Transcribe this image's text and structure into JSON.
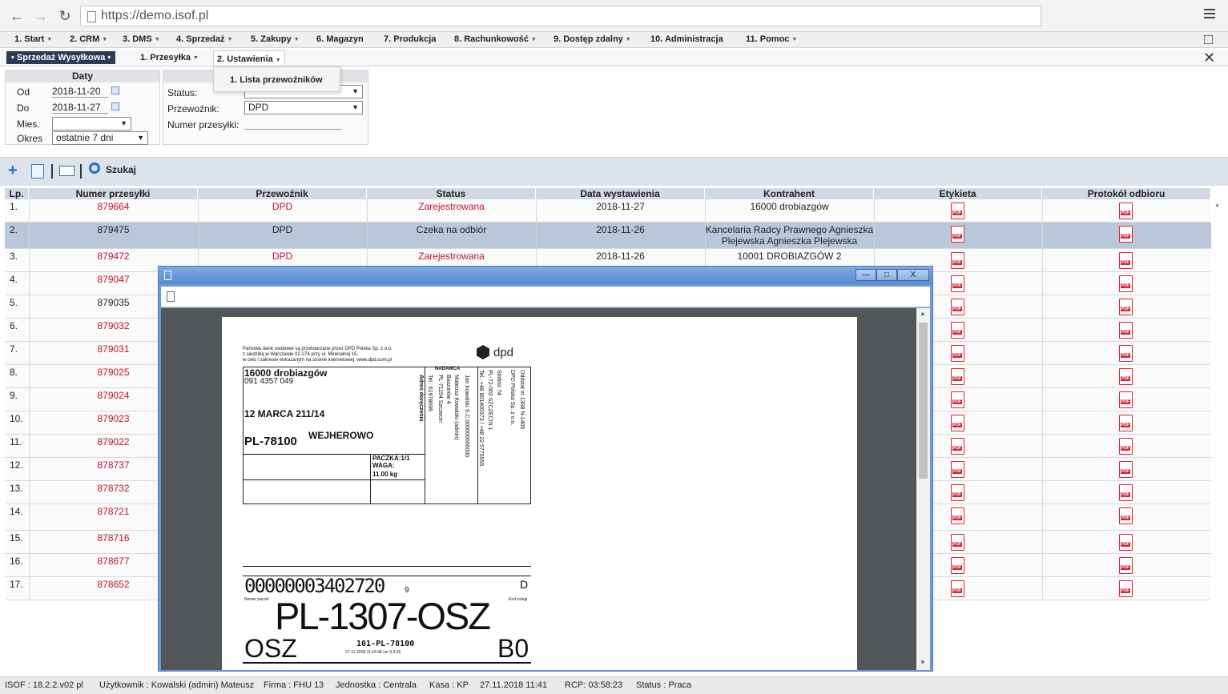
{
  "browser": {
    "url": "https://demo.isof.pl"
  },
  "main_menu": [
    {
      "label": "1. Start",
      "caret": true
    },
    {
      "label": "2. CRM",
      "caret": true
    },
    {
      "label": "3. DMS",
      "caret": true
    },
    {
      "label": "4. Sprzedaż",
      "caret": true
    },
    {
      "label": "5. Zakupy",
      "caret": true
    },
    {
      "label": "6. Magazyn",
      "caret": false
    },
    {
      "label": "7. Produkcja",
      "caret": false
    },
    {
      "label": "8. Rachunkowość",
      "caret": true
    },
    {
      "label": "9. Dostęp zdalny",
      "caret": true
    },
    {
      "label": "10. Administracja",
      "caret": false
    },
    {
      "label": "11. Pomoc",
      "caret": true
    }
  ],
  "sub_menu": {
    "active": "Sprzedaż Wysyłkowa",
    "item1": "1. Przesyłka",
    "item2": "2. Ustawienia",
    "dropdown_item": "1. Lista przewoźników"
  },
  "filters": {
    "dates_title": "Daty",
    "from_label": "Od",
    "from_value": "2018-11-20",
    "to_label": "Do",
    "to_value": "2018-11-27",
    "month_label": "Mies.",
    "month_value": "",
    "period_label": "Okres",
    "period_value": "ostatnie 7 dni",
    "status_label": "Status:",
    "status_value": "",
    "carrier_label": "Przewoźnik:",
    "carrier_value": "DPD",
    "number_label": "Numer przesyłki:",
    "number_value": ""
  },
  "toolbar": {
    "search_label": "Szukaj"
  },
  "table": {
    "headers": [
      "Lp.",
      "Numer przesyłki",
      "Przewoźnik",
      "Status",
      "Data wystawienia",
      "Kontrahent",
      "Etykieta",
      "Protokół odbioru"
    ],
    "rows": [
      {
        "lp": "1.",
        "num": "879664",
        "carrier": "DPD",
        "status": "Zarejestrowana",
        "date": "2018-11-27",
        "client": "16000 drobiazgów",
        "red": true
      },
      {
        "lp": "2.",
        "num": "879475",
        "carrier": "DPD",
        "status": "Czeka na odbiór",
        "date": "2018-11-26",
        "client": "Kancelaria Radcy Prawnego Agnieszka Plejewska Agnieszka Plejewska",
        "red": false
      },
      {
        "lp": "3.",
        "num": "879472",
        "carrier": "DPD",
        "status": "Zarejestrowana",
        "date": "2018-11-26",
        "client": "10001 DROBIAZGÓW 2",
        "red": true
      },
      {
        "lp": "4.",
        "num": "879047",
        "red": true
      },
      {
        "lp": "5.",
        "num": "879035",
        "red": false
      },
      {
        "lp": "6.",
        "num": "879032",
        "red": true
      },
      {
        "lp": "7.",
        "num": "879031",
        "red": true
      },
      {
        "lp": "8.",
        "num": "879025",
        "red": true
      },
      {
        "lp": "9.",
        "num": "879024",
        "red": true
      },
      {
        "lp": "10.",
        "num": "879023",
        "red": true
      },
      {
        "lp": "11.",
        "num": "879022",
        "red": true
      },
      {
        "lp": "12.",
        "num": "878737",
        "red": true
      },
      {
        "lp": "13.",
        "num": "878732",
        "red": true
      },
      {
        "lp": "14.",
        "num": "878721",
        "red": true
      },
      {
        "lp": "15.",
        "num": "878716",
        "red": true
      },
      {
        "lp": "16.",
        "num": "878677",
        "red": true
      },
      {
        "lp": "17.",
        "num": "878652",
        "red": true
      }
    ]
  },
  "popup": {
    "btn_min": "—",
    "btn_max": "□",
    "btn_close": "X",
    "label": {
      "privacy": [
        "Państwa dane osobowe są przetwarzane przez DPD Polska Sp. z o.o.",
        "z siedzibą w Warszawie 02-274 przy ul. Mineralnej 15,",
        "w celu i zakresie wskazanym na stronie internetowej: www.dpd.com.pl"
      ],
      "brand": "dpd",
      "recipient_name": "16000 drobiazgów",
      "recipient_phone": "091 4357 049",
      "recipient_street": "12 MARCA 211/14",
      "recipient_postal": "PL-78100",
      "recipient_city": "WEJHEROWO",
      "parcel": "PACZKA:1/1",
      "weight_label": "WAGA:",
      "weight": "11.00 kg",
      "v_address": "Adres doręczenia",
      "v_phone": "Tel.: 61978699",
      "v_sender_title": "NADAWCA",
      "v_sender1": "PL-71154 Szczecin",
      "v_sender2": "Baszarów 4",
      "v_sender3": "Mateusz Kowalski (admin)",
      "v_sender4": "Jan Kowalski S.C.000000000000",
      "v_branch1": "Tel.: +48 801400373 / +48 22 5775555",
      "v_branch2": "PL-72-002 SZCZECIN 1",
      "v_branch3": "Stobno 74",
      "v_branch4": "DPD Polska Sp. z o.o.",
      "v_branch5": "Oddział nr 1308  N-1405",
      "barcode_num": "00000003402720",
      "barcode_check": "9",
      "service_code": "D",
      "parcel_no_label": "Numer paczki",
      "service_label": "Kod usługi",
      "route": "PL-1307-OSZ",
      "depot": "OSZ",
      "route_sub": "101-PL-78100",
      "route_meta": "27-11-2018 11:16:38 ver 9.3.26",
      "sort_code": "B0"
    }
  },
  "statusbar": [
    "ISOF : 18.2.2.v02 pl",
    "Użytkownik : Kowalski (admin) Mateusz",
    "Firma : FHU 13",
    "Jednostka : Centrala",
    "Kasa : KP",
    "27.11.2018 11:41",
    "RCP: 03:58:23",
    "Status : Praca"
  ]
}
